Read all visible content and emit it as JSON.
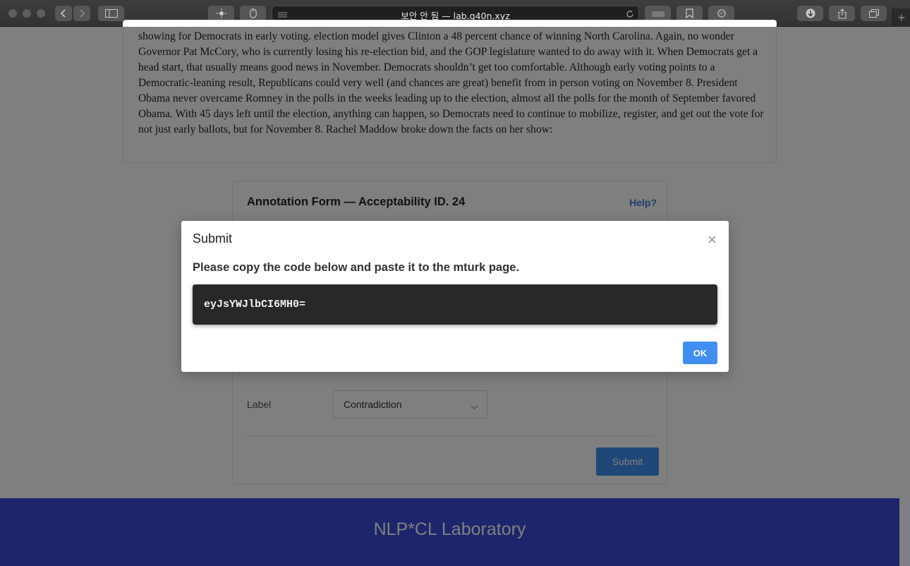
{
  "browser": {
    "address_title": "보안 안 됨 — lab.g40n.xyz",
    "new_tab_symbol": "+",
    "accent_dark": "#333335"
  },
  "article": {
    "text": "showing for Democrats in early voting. election model gives Clinton a 48 percent chance of winning North Carolina. Again, no wonder Governor Pat McCory, who is currently losing his re-election bid, and the GOP legislature wanted to do away with it. When Democrats get a head start, that usually means good news in November. Democrats shouldn’t get too comfortable. Although early voting points to a Democratic-leaning result, Republicans could very well (and chances are great) benefit from in person voting on November 8. President Obama never overcame Romney in the polls in the weeks leading up to the election, almost all the polls for the month of September favored Obama. With 45 days left until the election, anything can happen, so Democrats need to continue to mobilize, register, and get out the vote for not just early ballots, but for November 8. Rachel Maddow broke down the facts on her show:"
  },
  "form": {
    "title": "Annotation Form — Acceptability ID. 24",
    "help_label": "Help?",
    "label_caption": "Label",
    "label_value": "Contradiction",
    "submit_label": "Submit"
  },
  "footer": {
    "title": "NLP*CL Laboratory",
    "color": "#3a4bd9"
  },
  "modal": {
    "title": "Submit",
    "message": "Please copy the code below and paste it to the mturk page.",
    "code": "eyJsYWJlbCI6MH0=",
    "ok_label": "OK",
    "accent": "#3f8ef0"
  }
}
